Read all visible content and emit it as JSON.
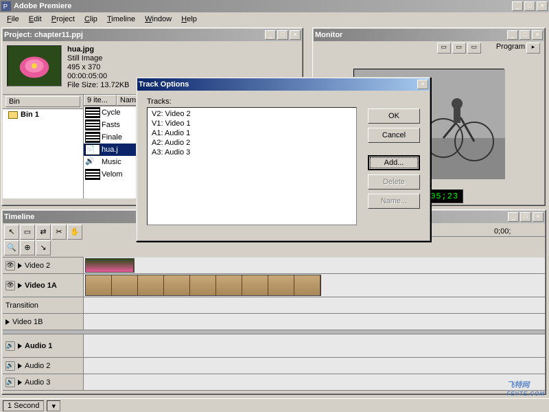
{
  "app": {
    "title": "Adobe Premiere"
  },
  "menu": [
    "File",
    "Edit",
    "Project",
    "Clip",
    "Timeline",
    "Window",
    "Help"
  ],
  "project": {
    "title": "Project: chapter11.ppj",
    "selected_file": {
      "name": "hua.jpg",
      "type": "Still Image",
      "dims": "495 x 370",
      "duration": "00:00:05:00",
      "filesize": "File Size: 13.72KB"
    },
    "bin_header_left": "Bin",
    "bin_header_count": "9 ite...",
    "bin_header_name": "Name",
    "bin_name": "Bin 1",
    "files": [
      {
        "name": "Cycle",
        "icon": "film"
      },
      {
        "name": "Fasts",
        "icon": "film"
      },
      {
        "name": "Finale",
        "icon": "film"
      },
      {
        "name": "hua.j",
        "icon": "doc",
        "selected": true
      },
      {
        "name": "Music",
        "icon": "audio"
      },
      {
        "name": "Velom",
        "icon": "film"
      }
    ]
  },
  "monitor": {
    "title": "Monitor",
    "program_label": "Program",
    "timecode": "00;00;05;23"
  },
  "timeline": {
    "title": "Timeline",
    "ruler": [
      "0;00",
      "0;00;",
      "0;00;",
      "0;00;"
    ],
    "tracks": [
      {
        "label": "Video 2",
        "eye": true,
        "type": "video"
      },
      {
        "label": "Video 1A",
        "eye": true,
        "type": "video",
        "bold": true,
        "clip": true
      },
      {
        "label": "Transition",
        "type": "transition"
      },
      {
        "label": "Video 1B",
        "type": "video"
      },
      {
        "label": "Audio 1",
        "eye": true,
        "type": "audio",
        "bold": true
      },
      {
        "label": "Audio 2",
        "eye": true,
        "type": "audio"
      },
      {
        "label": "Audio 3",
        "eye": true,
        "type": "audio"
      }
    ]
  },
  "dialog": {
    "title": "Track Options",
    "list_label": "Tracks:",
    "tracks": [
      "V2:  Video 2",
      "V1:  Video 1",
      "A1:  Audio 1",
      "A2:  Audio 2",
      "A3:  Audio 3"
    ],
    "buttons": {
      "ok": "OK",
      "cancel": "Cancel",
      "add": "Add...",
      "delete": "Delete",
      "name": "Name..."
    }
  },
  "status": {
    "zoom": "1 Second"
  },
  "watermark": {
    "text": "飞特网",
    "url": "FEVTE.COM"
  }
}
